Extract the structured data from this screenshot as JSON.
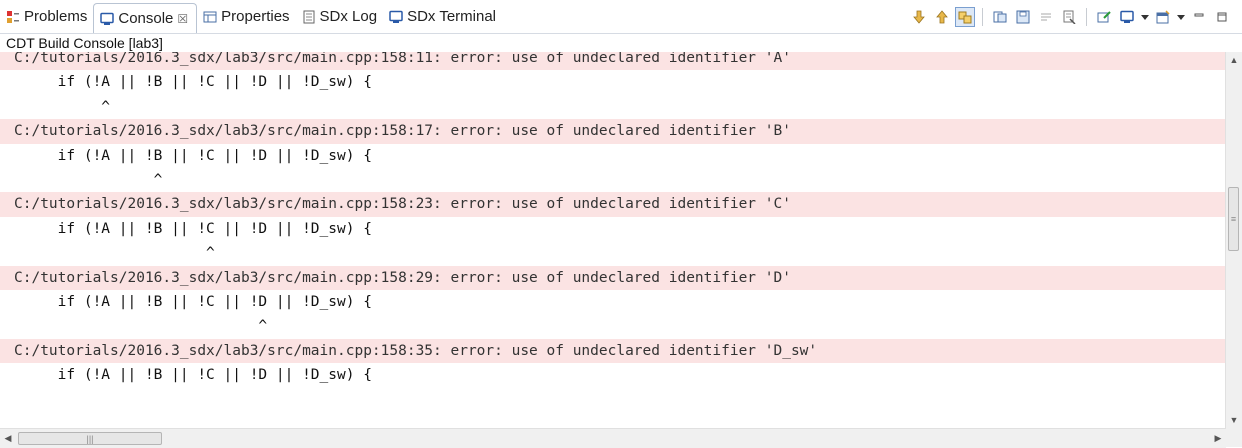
{
  "tabs": [
    {
      "label": "Problems",
      "icon": "problems-icon"
    },
    {
      "label": "Console",
      "icon": "console-icon",
      "active": true,
      "close": "☒"
    },
    {
      "label": "Properties",
      "icon": "properties-icon"
    },
    {
      "label": "SDx Log",
      "icon": "log-icon"
    },
    {
      "label": "SDx Terminal",
      "icon": "terminal-icon"
    }
  ],
  "subtitle": "CDT Build Console [lab3]",
  "console_lines": [
    {
      "text": "C:/tutorials/2016.3_sdx/lab3/src/main.cpp:158:11: error: use of undeclared identifier 'A'",
      "type": "error"
    },
    {
      "text": "     if (!A || !B || !C || !D || !D_sw) {",
      "type": "code"
    },
    {
      "text": "          ^",
      "type": "code"
    },
    {
      "text": "C:/tutorials/2016.3_sdx/lab3/src/main.cpp:158:17: error: use of undeclared identifier 'B'",
      "type": "error"
    },
    {
      "text": "     if (!A || !B || !C || !D || !D_sw) {",
      "type": "code"
    },
    {
      "text": "                ^",
      "type": "code"
    },
    {
      "text": "C:/tutorials/2016.3_sdx/lab3/src/main.cpp:158:23: error: use of undeclared identifier 'C'",
      "type": "error"
    },
    {
      "text": "     if (!A || !B || !C || !D || !D_sw) {",
      "type": "code"
    },
    {
      "text": "                      ^",
      "type": "code"
    },
    {
      "text": "C:/tutorials/2016.3_sdx/lab3/src/main.cpp:158:29: error: use of undeclared identifier 'D'",
      "type": "error"
    },
    {
      "text": "     if (!A || !B || !C || !D || !D_sw) {",
      "type": "code"
    },
    {
      "text": "                            ^",
      "type": "code"
    },
    {
      "text": "C:/tutorials/2016.3_sdx/lab3/src/main.cpp:158:35: error: use of undeclared identifier 'D_sw'",
      "type": "error"
    },
    {
      "text": "     if (!A || !B || !C || !D || !D_sw) {",
      "type": "code"
    }
  ],
  "colors": {
    "error_bg": "#fbe3e3",
    "active_tab_border": "#b9c4d3"
  }
}
